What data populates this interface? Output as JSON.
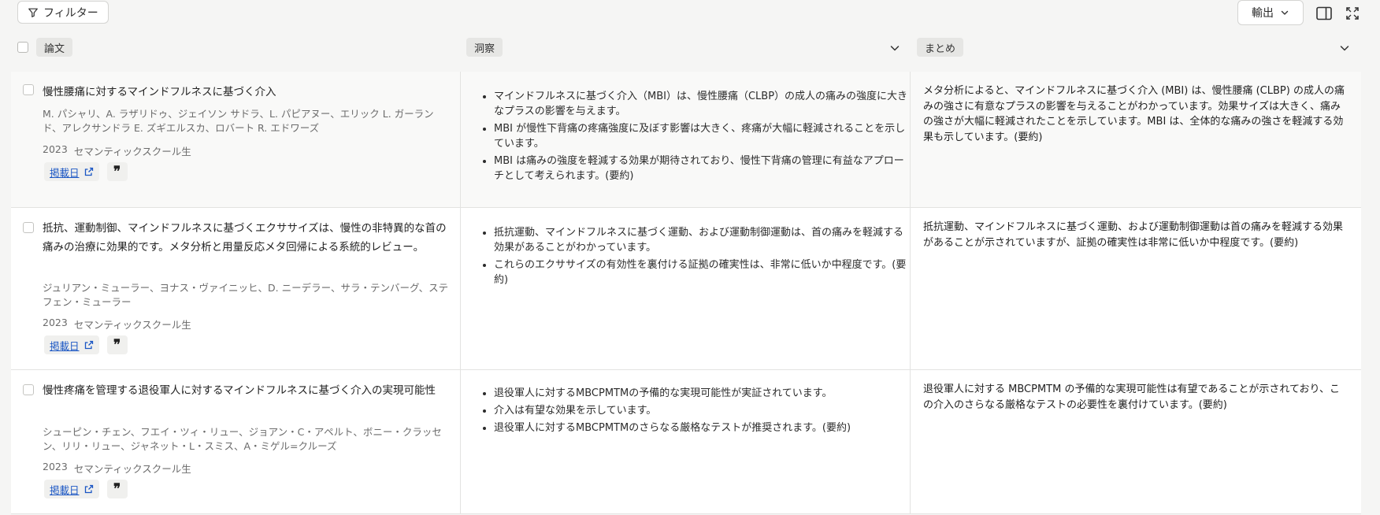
{
  "toolbar": {
    "filter_label": "フィルター",
    "export_label": "輸出",
    "sidebar_toggle_icon": "panel-right-icon",
    "fullscreen_icon": "expand-icon"
  },
  "columns": {
    "paper": "論文",
    "insights": "洞察",
    "summary": "まとめ"
  },
  "rows": [
    {
      "title": "慢性腰痛に対するマインドフルネスに基づく介入",
      "authors": "M. パシャリ、A. ラザリドゥ、ジェイソン サドラ、L. パピアヌー、エリック L. ガーランド、アレクサンドラ E. ズギエルスカ、ロバート R. エドワーズ",
      "year": "2023",
      "source": "セマンティックスクール生",
      "pub_label": "掲載日",
      "insights": [
        "マインドフルネスに基づく介入（MBI）は、慢性腰痛（CLBP）の成人の痛みの強度に大きなプラスの影響を与えます。",
        "MBI が慢性下背痛の疼痛強度に及ぼす影響は大きく、疼痛が大幅に軽減されることを示しています。",
        "MBI は痛みの強度を軽減する効果が期待されており、慢性下背痛の管理に有益なアプローチとして考えられます。(要約)"
      ],
      "summary": "メタ分析によると、マインドフルネスに基づく介入 (MBI) は、慢性腰痛 (CLBP) の成人の痛みの強さに有意なプラスの影響を与えることがわかっています。効果サイズは大きく、痛みの強さが大幅に軽減されたことを示しています。MBI は、全体的な痛みの強さを軽減する効果も示しています。(要約)"
    },
    {
      "title": "抵抗、運動制御、マインドフルネスに基づくエクササイズは、慢性の非特異的な首の痛みの治療に効果的です。メタ分析と用量反応メタ回帰による系統的レビュー。",
      "authors": "ジュリアン・ミューラー、ヨナス・ヴァイニッヒ、D. ニーデラー、サラ・テンバーグ、ステフェン・ミューラー",
      "year": "2023",
      "source": "セマンティックスクール生",
      "pub_label": "掲載日",
      "insights": [
        "抵抗運動、マインドフルネスに基づく運動、および運動制御運動は、首の痛みを軽減する効果があることがわかっています。",
        "これらのエクササイズの有効性を裏付ける証拠の確実性は、非常に低いか中程度です。(要約)"
      ],
      "summary": "抵抗運動、マインドフルネスに基づく運動、および運動制御運動は首の痛みを軽減する効果があることが示されていますが、証拠の確実性は非常に低いか中程度です。(要約)"
    },
    {
      "title": "慢性疼痛を管理する退役軍人に対するマインドフルネスに基づく介入の実現可能性",
      "authors": "シューピン・チェン、フエイ・ツィ・リュー、ジョアン・C・アペルト、ボニー・クラッセン、リリ・リュー、ジャネット・L・スミス、A・ミゲル=クルーズ",
      "year": "2023",
      "source": "セマンティックスクール生",
      "pub_label": "掲載日",
      "insights": [
        "退役軍人に対するMBCPMTMの予備的な実現可能性が実証されています。",
        "介入は有望な効果を示しています。",
        "退役軍人に対するMBCPMTMのさらなる厳格なテストが推奨されます。(要約)"
      ],
      "summary": "退役軍人に対する MBCPMTM の予備的な実現可能性は有望であることが示されており、この介入のさらなる厳格なテストの必要性を裏付けています。(要約)"
    }
  ]
}
